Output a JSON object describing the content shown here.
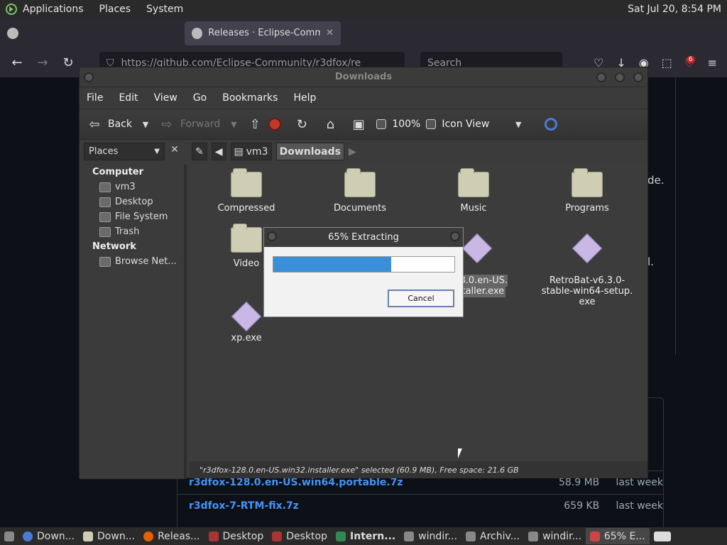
{
  "top_panel": {
    "menus": [
      "Applications",
      "Places",
      "System"
    ],
    "clock": "Sat Jul 20,  8:54 PM"
  },
  "browser": {
    "tabs": [
      {
        "label": "",
        "active": false
      },
      {
        "label": "Releases · Eclipse-Commun",
        "active": true
      }
    ],
    "url": "https://github.com/Eclipse-Community/r3dfox/re",
    "search_placeholder": "Search",
    "extension_badge": "6"
  },
  "github": {
    "fragments": [
      "de.",
      "l."
    ],
    "assets": [
      {
        "name": "r3dfox-128.0.en-US.win64.portable.7z",
        "size": "58.9 MB",
        "date": "last week"
      },
      {
        "name": "r3dfox-7-RTM-fix.7z",
        "size": "659 KB",
        "date": "last week"
      }
    ]
  },
  "file_manager": {
    "title": "Downloads",
    "menu": [
      "File",
      "Edit",
      "View",
      "Go",
      "Bookmarks",
      "Help"
    ],
    "toolbar": {
      "back": "Back",
      "forward": "Forward",
      "zoom": "100%",
      "view_mode": "Icon View"
    },
    "sidebar_combo": "Places",
    "breadcrumbs": [
      "vm3",
      "Downloads"
    ],
    "sidebar": {
      "sections": [
        {
          "title": "Computer",
          "items": [
            "vm3",
            "Desktop",
            "File System",
            "Trash"
          ]
        },
        {
          "title": "Network",
          "items": [
            "Browse Net..."
          ]
        }
      ]
    },
    "files": [
      {
        "name": "Compressed",
        "type": "folder"
      },
      {
        "name": "Documents",
        "type": "folder"
      },
      {
        "name": "Music",
        "type": "folder"
      },
      {
        "name": "Programs",
        "type": "folder"
      },
      {
        "name": "Video",
        "type": "folder"
      },
      {
        "name": "128.0.en-US.\ninstaller.exe",
        "type": "exe"
      },
      {
        "name": "RetroBat-v6.3.0-\nstable-win64-setup.\nexe",
        "type": "exe"
      },
      {
        "name": "xp.exe",
        "type": "exe"
      }
    ],
    "status": "\"r3dfox-128.0.en-US.win32.installer.exe\" selected (60.9 MB), Free space: 21.6 GB"
  },
  "dialog": {
    "title": "65% Extracting",
    "progress": 0.65,
    "cancel_label": "Cancel"
  },
  "taskbar": {
    "tasks": [
      "Down...",
      "Down...",
      "Releas...",
      "Desktop",
      "Desktop",
      "Intern...",
      "windir...",
      "Archiv...",
      "windir...",
      "65% E..."
    ]
  }
}
